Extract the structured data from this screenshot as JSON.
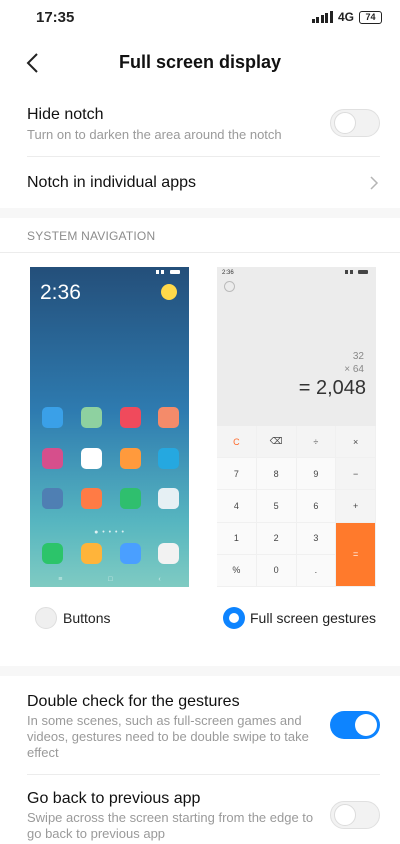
{
  "status_bar": {
    "time": "17:35",
    "network": "4G",
    "battery": "74"
  },
  "header": {
    "title": "Full screen display"
  },
  "settings": {
    "hide_notch": {
      "title": "Hide notch",
      "subtitle": "Turn on to darken the area around the notch",
      "enabled": false
    },
    "notch_apps": {
      "title": "Notch in individual apps"
    }
  },
  "system_navigation": {
    "section_label": "SYSTEM NAVIGATION",
    "home_preview": {
      "clock": "2:36"
    },
    "calc_preview": {
      "time": "2:36",
      "operand1": "32",
      "operand2": "× 64",
      "result": "= 2,048",
      "keys": [
        "C",
        "⌫",
        "÷",
        "×",
        "7",
        "8",
        "9",
        "−",
        "4",
        "5",
        "6",
        "+",
        "1",
        "2",
        "3",
        "%",
        "0",
        ".",
        "="
      ]
    },
    "options": [
      {
        "label": "Buttons",
        "selected": false
      },
      {
        "label": "Full screen gestures",
        "selected": true
      }
    ]
  },
  "gestures": {
    "double_check": {
      "title": "Double check for the gestures",
      "subtitle": "In some scenes, such as full-screen games and videos, gestures need to be double swipe to take effect",
      "enabled": true
    },
    "go_back": {
      "title": "Go back to previous app",
      "subtitle": "Swipe across the screen starting from the edge to go back to previous app",
      "enabled": false
    }
  },
  "colors": {
    "accent": "#0d84ff",
    "calc_equals": "#ff7a2c"
  }
}
